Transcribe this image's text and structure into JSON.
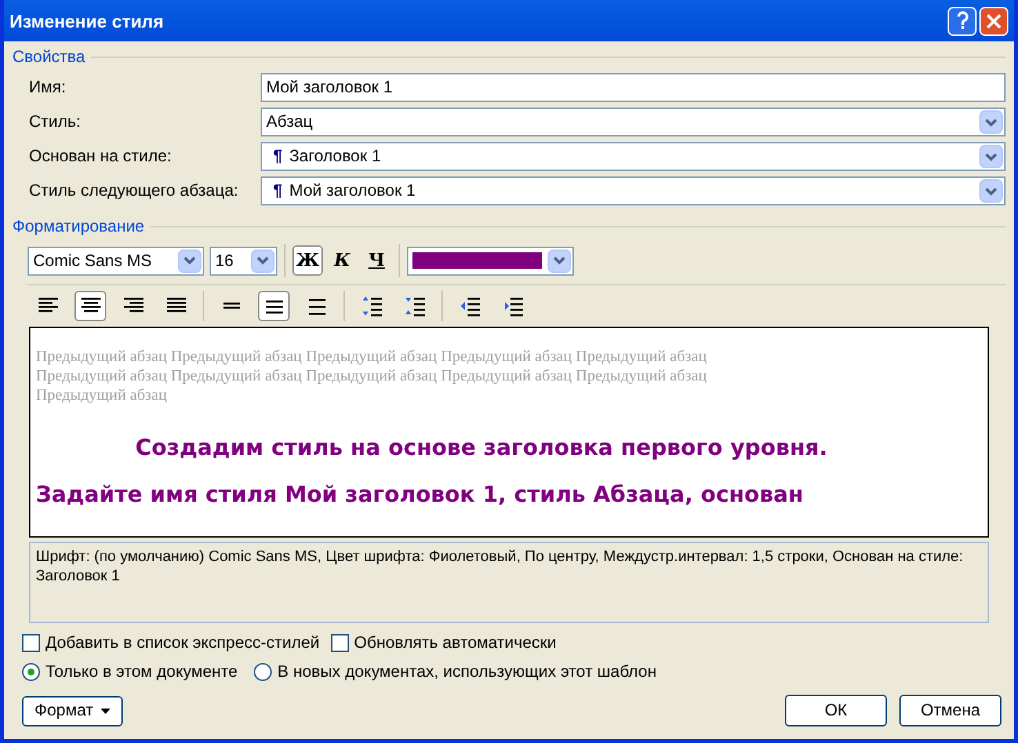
{
  "window": {
    "title": "Изменение стиля"
  },
  "properties": {
    "heading": "Свойства",
    "fields": [
      {
        "label": "Имя:",
        "value": "Мой заголовок 1",
        "kind": "text"
      },
      {
        "label": "Стиль:",
        "value": "Абзац",
        "kind": "select"
      },
      {
        "label": "Основан на стиле:",
        "value": "Заголовок 1",
        "kind": "para-select",
        "mark": "¶"
      },
      {
        "label": "Стиль следующего абзаца:",
        "value": "Мой заголовок 1",
        "kind": "para-select",
        "mark": "¶"
      }
    ]
  },
  "formatting": {
    "heading": "Форматирование",
    "font": "Comic Sans MS",
    "size": "16",
    "toggles": [
      {
        "label": "Ж",
        "selected": true,
        "kind": "bold"
      },
      {
        "label": "К",
        "selected": false,
        "kind": "italic"
      },
      {
        "label": "Ч",
        "selected": false,
        "kind": "underline"
      }
    ],
    "color": "#800080",
    "paragraph_buttons": [
      {
        "kind": "align-left",
        "selected": false
      },
      {
        "kind": "align-center",
        "selected": true
      },
      {
        "kind": "align-right",
        "selected": false
      },
      {
        "kind": "justify",
        "selected": false
      },
      {
        "kind": "single",
        "selected": false
      },
      {
        "kind": "one-half",
        "selected": true
      },
      {
        "kind": "double",
        "selected": false
      },
      {
        "kind": "space-up",
        "selected": false
      },
      {
        "kind": "space-down",
        "selected": false
      },
      {
        "kind": "outdent",
        "selected": false
      },
      {
        "kind": "indent",
        "selected": false
      }
    ]
  },
  "preview": {
    "previous_lines": [
      "Предыдущий абзац Предыдущий абзац Предыдущий абзац Предыдущий абзац Предыдущий абзац",
      "Предыдущий абзац Предыдущий абзац Предыдущий абзац Предыдущий абзац Предыдущий абзац",
      "Предыдущий абзац"
    ],
    "sample_lines": [
      "Создадим стиль на основе заголовка первого уровня.",
      "Задайте имя стиля Мой заголовок 1, стиль Абзаца, основан"
    ]
  },
  "description": "Шрифт: (по умолчанию) Comic Sans MS, Цвет шрифта: Фиолетовый, По центру, Междустр.интервал:  1,5 строки, Основан на стиле: Заголовок 1",
  "checkboxes": [
    {
      "label": "Добавить в список экспресс-стилей",
      "checked": false
    },
    {
      "label": "Обновлять автоматически",
      "checked": false
    }
  ],
  "radios": [
    {
      "label": "Только в этом документе",
      "selected": true
    },
    {
      "label": "В новых документах, использующих этот шаблон",
      "selected": false
    }
  ],
  "buttons": {
    "format": "Формат",
    "ok": "ОК",
    "cancel": "Отмена"
  }
}
